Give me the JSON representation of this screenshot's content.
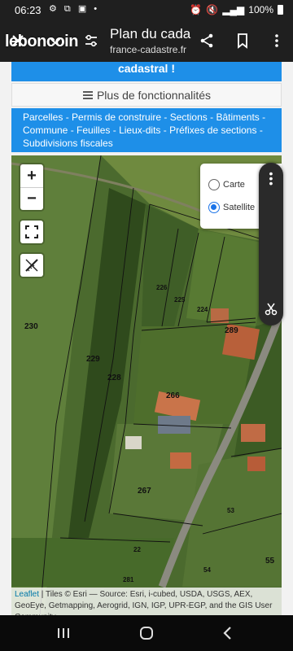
{
  "status_bar": {
    "time": "06:23",
    "battery": "100%"
  },
  "toolbar": {
    "brand": "leboncoin",
    "title": "Plan du cada...",
    "url": "france-cadastre.fr",
    "close_icon": "close-icon",
    "chevron_icon": "chevron-down-icon",
    "tune_icon": "tune-icon",
    "share_icon": "share-icon",
    "bookmark_icon": "bookmark-icon",
    "menu_icon": "more-vert-icon"
  },
  "page": {
    "banner_text": "cadastral !",
    "more_features": "Plus de fonctionnalités",
    "links": [
      "Parcelles",
      "Permis de construire",
      "Sections",
      "Bâtiments",
      "Commune",
      "Feuilles",
      "Lieux-dits",
      "Préfixes de sections",
      "Subdivisions fiscales"
    ],
    "link_separator": " - "
  },
  "map": {
    "zoom_in": "+",
    "zoom_out": "−",
    "layers": [
      {
        "label": "Carte",
        "selected": false
      },
      {
        "label": "Satellite",
        "selected": true
      }
    ],
    "parcel_labels": [
      "230",
      "229",
      "228",
      "225",
      "226",
      "224",
      "289",
      "266",
      "267",
      "53",
      "54",
      "55",
      "281",
      "22"
    ],
    "attribution_link": "Leaflet",
    "attribution_text": " | Tiles © Esri — Source: Esri, i-cubed, USDA, USGS, AEX, GeoEye, Getmapping, Aerogrid, IGN, IGP, UPR-EGP, and the GIS User Community"
  },
  "nav": {
    "recents_icon": "recents-icon",
    "home_icon": "home-icon",
    "back_icon": "back-icon"
  },
  "colors": {
    "accent_blue": "#1e8fe8",
    "dark_bar": "#1f1f1f"
  }
}
